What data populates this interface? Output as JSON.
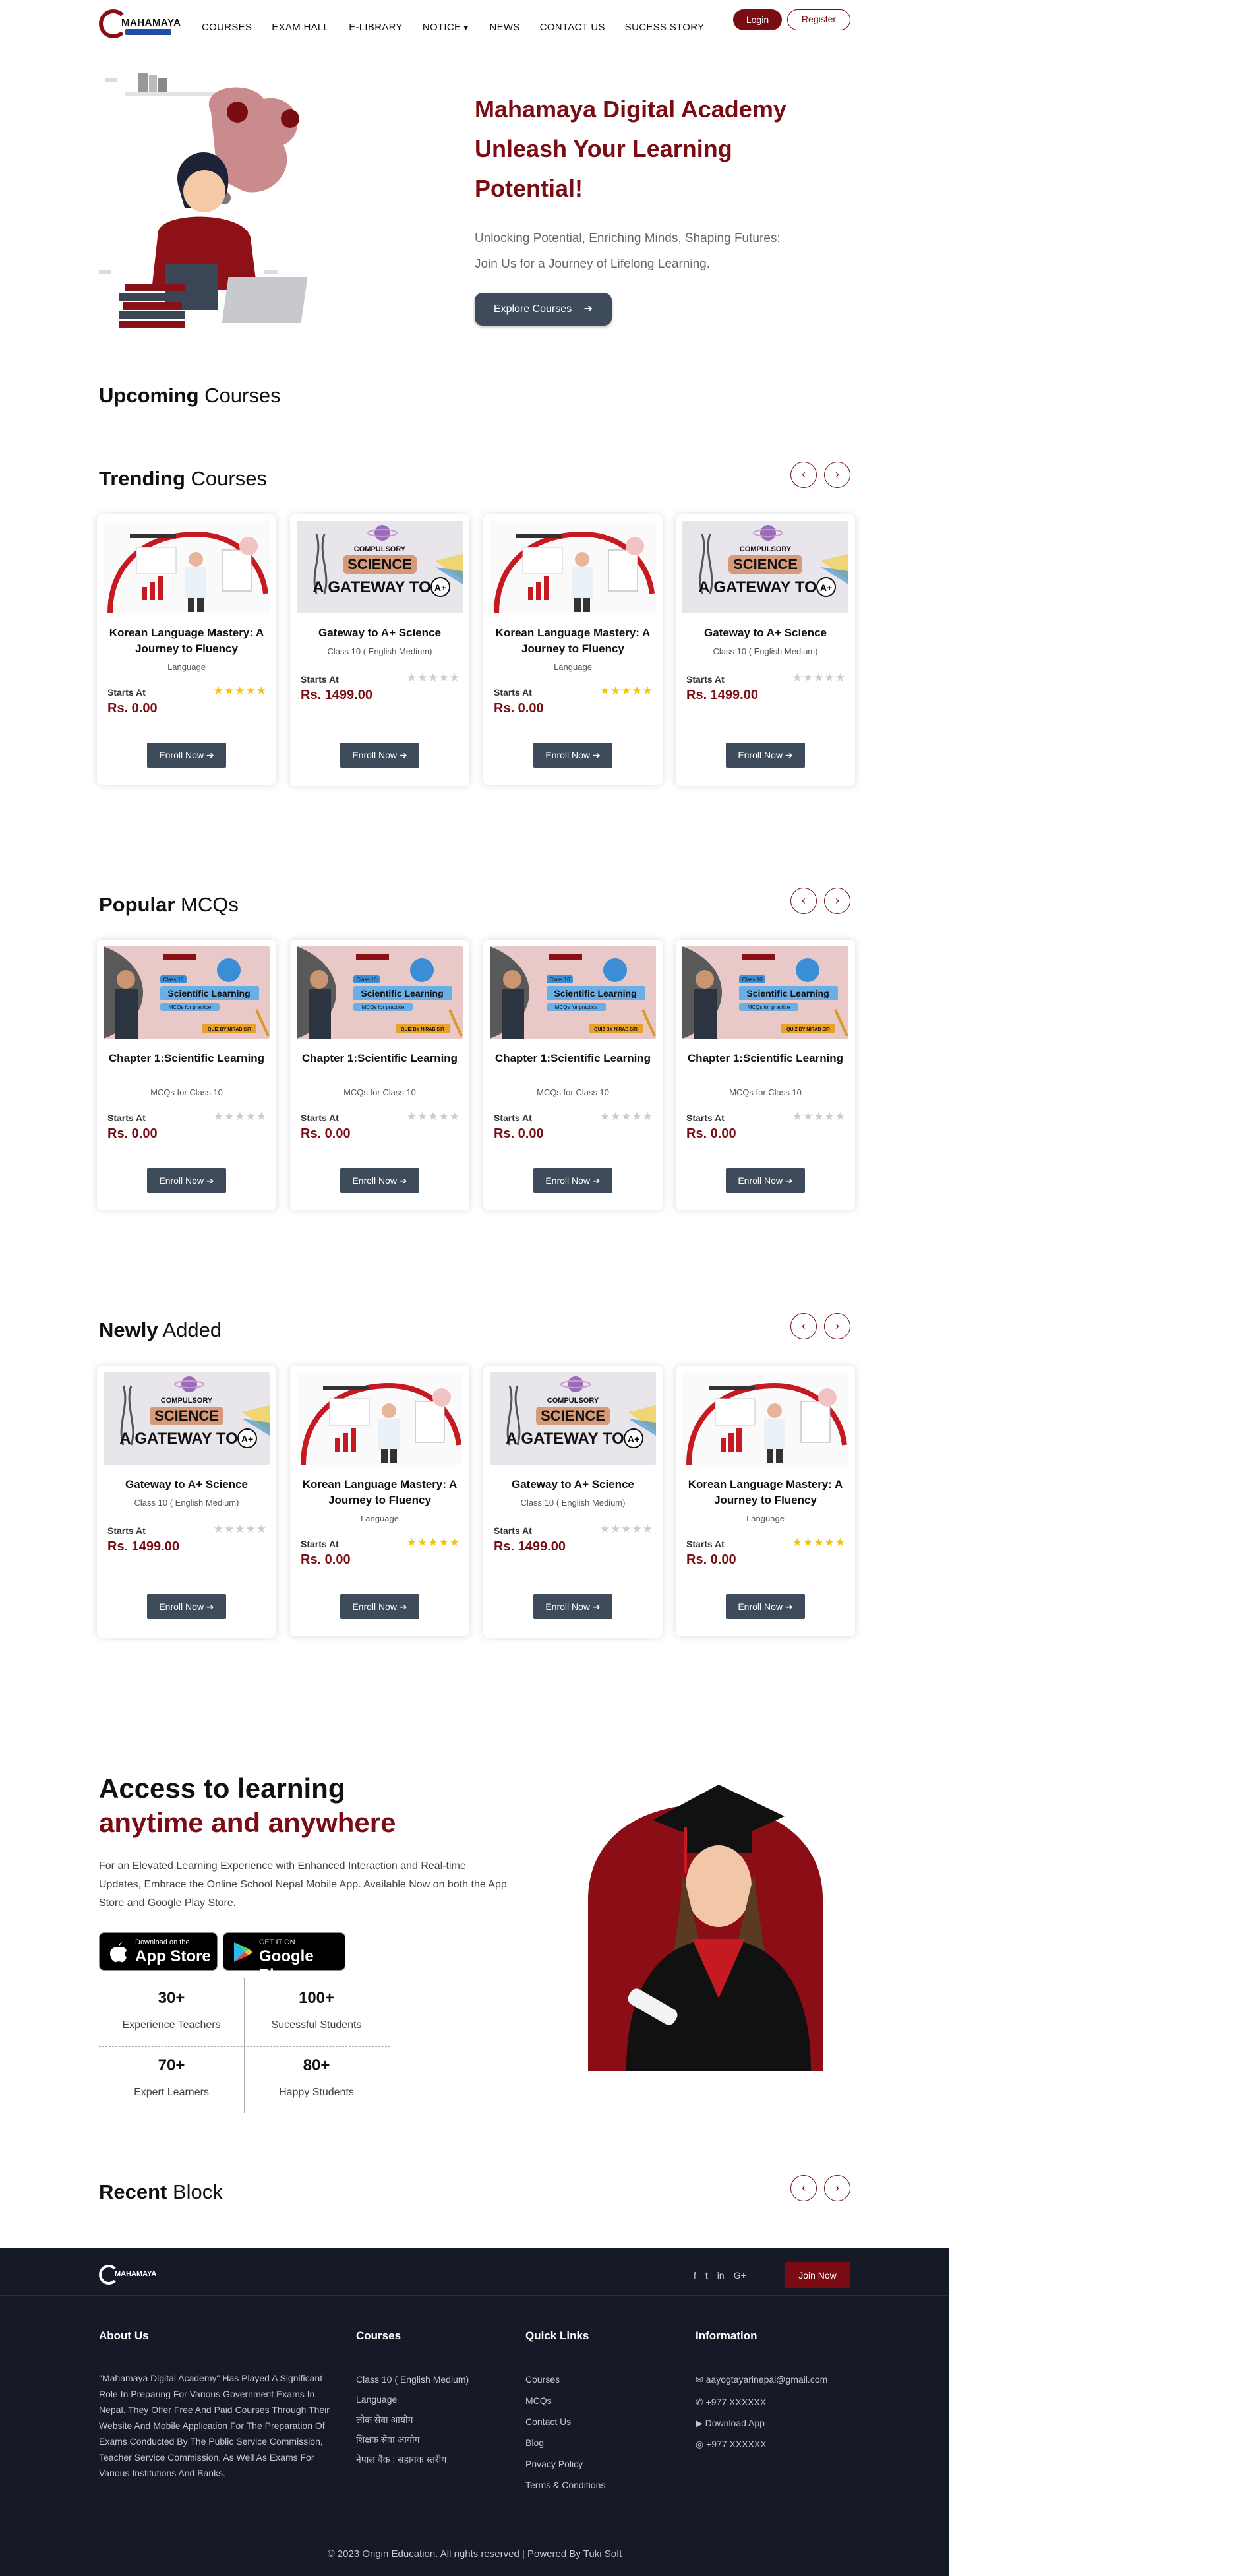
{
  "nav": {
    "logo_text": "MAHAMAYA",
    "items": [
      "COURSES",
      "EXAM HALL",
      "E-LIBRARY",
      "NOTICE",
      "NEWS",
      "CONTACT US",
      "SUCESS STORY"
    ],
    "login": "Login",
    "register": "Register"
  },
  "hero": {
    "title_line1": "Mahamaya Digital Academy",
    "title_line2": "Unleash Your Learning",
    "title_line3": "Potential!",
    "sub_line1": "Unlocking Potential, Enriching Minds, Shaping Futures:",
    "sub_line2": "Join Us for a Journey of Lifelong Learning.",
    "cta": "Explore Courses"
  },
  "upcoming": {
    "bold": "Upcoming",
    "rest": " Courses"
  },
  "trending": {
    "bold": "Trending",
    "rest": " Courses",
    "cards": [
      {
        "title": "Korean Language Mastery: A Journey to Fluency",
        "sub": "Language",
        "starts": "Starts At",
        "price": "Rs. 0.00",
        "rating": "★★★★★",
        "enroll": "Enroll Now"
      },
      {
        "title": "Gateway to A+ Science",
        "sub": "Class 10 ( English Medium)",
        "starts": "Starts At",
        "price": "Rs. 1499.00",
        "rating": "★★★★★",
        "enroll": "Enroll Now"
      },
      {
        "title": "Korean Language Mastery: A Journey to Fluency",
        "sub": "Language",
        "starts": "Starts At",
        "price": "Rs. 0.00",
        "rating": "★★★★★",
        "enroll": "Enroll Now"
      },
      {
        "title": "Gateway to A+ Science",
        "sub": "Class 10 ( English Medium)",
        "starts": "Starts At",
        "price": "Rs. 1499.00",
        "rating": "★★★★★",
        "enroll": "Enroll Now"
      }
    ]
  },
  "popular": {
    "bold": "Popular",
    "rest": " MCQs",
    "cards": [
      {
        "title": "Chapter 1:Scientific Learning",
        "sub": "MCQs for Class 10",
        "starts": "Starts At",
        "price": "Rs. 0.00",
        "rating": "★★★★★",
        "enroll": "Enroll Now"
      },
      {
        "title": "Chapter 1:Scientific Learning",
        "sub": "MCQs for Class 10",
        "starts": "Starts At",
        "price": "Rs. 0.00",
        "rating": "★★★★★",
        "enroll": "Enroll Now"
      },
      {
        "title": "Chapter 1:Scientific Learning",
        "sub": "MCQs for Class 10",
        "starts": "Starts At",
        "price": "Rs. 0.00",
        "rating": "★★★★★",
        "enroll": "Enroll Now"
      },
      {
        "title": "Chapter 1:Scientific Learning",
        "sub": "MCQs for Class 10",
        "starts": "Starts At",
        "price": "Rs. 0.00",
        "rating": "★★★★★",
        "enroll": "Enroll Now"
      }
    ],
    "thumb": {
      "tag": "Class 10",
      "title": "Scientific Learning",
      "sub": "MCQs for practice",
      "by": "QUIZ BY NIRAB SIR"
    }
  },
  "newly": {
    "bold": "Newly",
    "rest": " Added",
    "cards": [
      {
        "title": "Gateway to A+ Science",
        "sub": "Class 10 ( English Medium)",
        "starts": "Starts At",
        "price": "Rs. 1499.00",
        "rating": "★★★★★",
        "enroll": "Enroll Now"
      },
      {
        "title": "Korean Language Mastery: A Journey to Fluency",
        "sub": "Language",
        "starts": "Starts At",
        "price": "Rs. 0.00",
        "rating": "★★★★★",
        "enroll": "Enroll Now"
      },
      {
        "title": "Gateway to A+ Science",
        "sub": "Class 10 ( English Medium)",
        "starts": "Starts At",
        "price": "Rs. 1499.00",
        "rating": "★★★★★",
        "enroll": "Enroll Now"
      },
      {
        "title": "Korean Language Mastery: A Journey to Fluency",
        "sub": "Language",
        "starts": "Starts At",
        "price": "Rs. 0.00",
        "rating": "★★★★★",
        "enroll": "Enroll Now"
      }
    ]
  },
  "science_thumb": {
    "top": "COMPULSORY",
    "mid": "SCIENCE",
    "bottom": "A GATEWAY TO",
    "grade": "A+"
  },
  "access": {
    "title1": "Access to learning",
    "title2": "anytime and anywhere",
    "desc": "For an Elevated Learning Experience with Enhanced Interaction and Real-time Updates, Embrace the Online School Nepal Mobile App. Available Now on both the App Store and Google Play Store.",
    "appstore_small": "Download on the",
    "appstore_big": "App Store",
    "gplay_small": "GET IT ON",
    "gplay_big": "Google Play",
    "stats": [
      {
        "num": "30+",
        "label": "Experience Teachers"
      },
      {
        "num": "100+",
        "label": "Sucessful Students"
      },
      {
        "num": "70+",
        "label": "Expert Learners"
      },
      {
        "num": "80+",
        "label": "Happy Students"
      }
    ]
  },
  "recent": {
    "bold": "Recent",
    "rest": " Block"
  },
  "footer": {
    "logo_text": "MAHAMAYA",
    "social": [
      "f",
      "t",
      "in",
      "G+"
    ],
    "join": "Join Now",
    "about_h": "About Us",
    "about_txt": "\"Mahamaya Digital Academy\" Has Played A Significant Role In Preparing For Various Government Exams In Nepal. They Offer Free And Paid Courses Through Their Website And Mobile Application For The Preparation Of Exams Conducted By The Public Service Commission, Teacher Service Commission, As Well As Exams For Various Institutions And Banks.",
    "courses_h": "Courses",
    "courses": [
      "Class 10 ( English Medium)",
      "Language",
      "लोक सेवा आयोग",
      "शिक्षक सेवा आयोग",
      "नेपाल बैंक : सहायक स्तरीय"
    ],
    "links_h": "Quick Links",
    "links": [
      "Courses",
      "MCQs",
      "Contact Us",
      "Blog",
      "Privacy Policy",
      "Terms & Conditions"
    ],
    "info_h": "Information",
    "info": [
      "aayogtayarinepal@gmail.com",
      "+977 XXXXXX",
      "Download App",
      "+977 XXXXXX"
    ],
    "copyright": "© 2023 Origin Education. All rights reserved | Powered By Tuki Soft"
  },
  "colors": {
    "brand": "#7a0c14",
    "button_dark": "#3e4b5a",
    "footer_bg": "#161a26",
    "star": "#f5c400"
  }
}
